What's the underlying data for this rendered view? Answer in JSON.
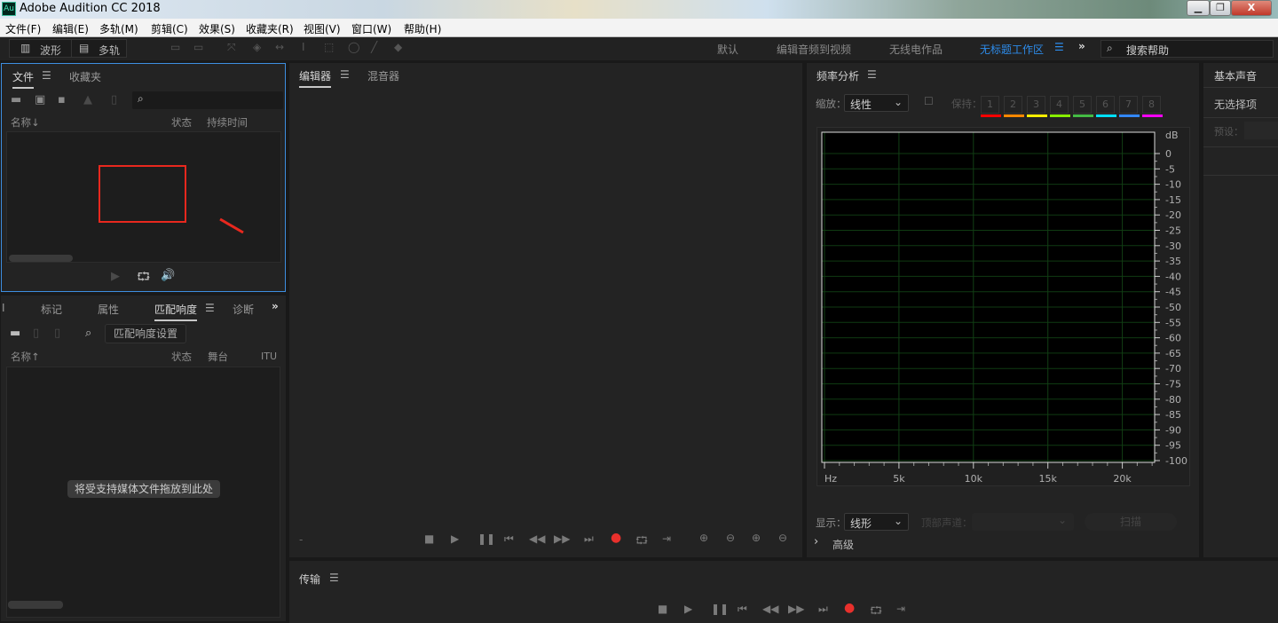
{
  "window": {
    "app_icon": "Au",
    "title": "Adobe Audition CC 2018",
    "minimize": "▁",
    "restore": "❐",
    "close": "X"
  },
  "menu": [
    "文件(F)",
    "编辑(E)",
    "多轨(M)",
    "剪辑(C)",
    "效果(S)",
    "收藏夹(R)",
    "视图(V)",
    "窗口(W)",
    "帮助(H)"
  ],
  "toolbar": {
    "waveform": "波形",
    "multitrack": "多轨",
    "workspaces": [
      "默认",
      "编辑音频到视频",
      "无线电作品",
      "无标题工作区"
    ],
    "active_workspace": "无标题工作区",
    "more": "»",
    "search_placeholder": "搜索帮助"
  },
  "files_panel": {
    "tabs": [
      "文件",
      "收藏夹"
    ],
    "columns": [
      "名称",
      "状态",
      "持续时间"
    ],
    "sort_arrow": "↓"
  },
  "lower_panel": {
    "tabs": [
      "I",
      "标记",
      "属性",
      "匹配响度",
      "诊断"
    ],
    "more": "»",
    "settings_button": "匹配响度设置",
    "columns": [
      "名称",
      "状态",
      "舞台",
      "ITU"
    ],
    "sort_arrow": "↑",
    "drop_hint": "将受支持媒体文件拖放到此处"
  },
  "editor": {
    "tabs": [
      "编辑器",
      "混音器"
    ],
    "timecode": "-"
  },
  "frequency": {
    "title": "频率分析",
    "scale_label": "缩放：",
    "scale_value": "线性",
    "hold_label": "保持：",
    "hold_buttons": [
      "1",
      "2",
      "3",
      "4",
      "5",
      "6",
      "7",
      "8"
    ],
    "hold_colors": [
      "#ff0000",
      "#ff8800",
      "#ffee00",
      "#88ee00",
      "#44bb44",
      "#00e0ff",
      "#3388ff",
      "#ff00ff"
    ],
    "display_label": "显示：",
    "display_value": "线形",
    "channel_label": "顶部声道：",
    "scan_button": "扫描",
    "advanced": "高级"
  },
  "chart_data": {
    "type": "line",
    "x_unit": "Hz",
    "y_unit": "dB",
    "x_ticks": [
      "Hz",
      "5k",
      "10k",
      "15k",
      "20k"
    ],
    "x_tick_values": [
      0,
      5000,
      10000,
      15000,
      20000
    ],
    "xlim": [
      0,
      22050
    ],
    "y_ticks": [
      0,
      -5,
      -10,
      -15,
      -20,
      -25,
      -30,
      -35,
      -40,
      -45,
      -50,
      -55,
      -60,
      -65,
      -70,
      -75,
      -80,
      -85,
      -90,
      -95,
      -100
    ],
    "ylim": [
      -100,
      0
    ],
    "series": [],
    "grid": true
  },
  "essential_sound": {
    "title": "基本声音",
    "no_selection": "无选择项",
    "preset_label": "预设："
  },
  "transport": {
    "title": "传输"
  }
}
